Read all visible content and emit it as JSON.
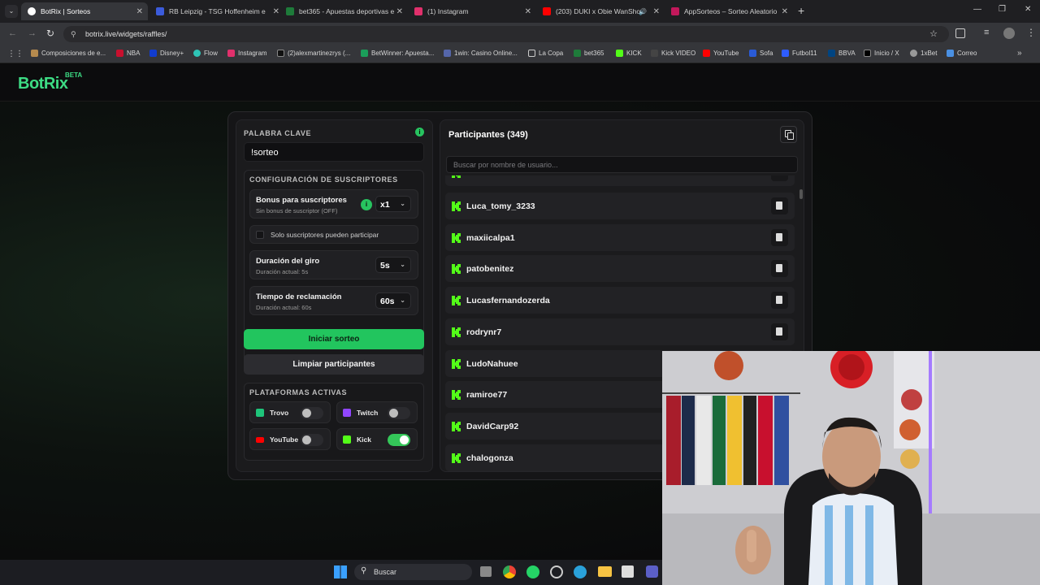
{
  "browser": {
    "tabs": [
      {
        "title": "BotRix | Sorteos",
        "active": true,
        "color": "#ffffff"
      },
      {
        "title": "RB Leipzig - TSG Hoffenheim e",
        "active": false,
        "color": "#3b5bdb"
      },
      {
        "title": "bet365 - Apuestas deportivas e",
        "active": false,
        "color": "#1e7b3a"
      },
      {
        "title": "(1) Instagram",
        "active": false,
        "color": "#e1306c"
      },
      {
        "title": "(203) DUKI x Obie WanShot",
        "active": false,
        "color": "#ff0000"
      },
      {
        "title": "AppSorteos – Sorteo Aleatorio",
        "active": false,
        "color": "#c2185b"
      }
    ],
    "url": "botrix.live/widgets/raffles/",
    "bookmarks": [
      "Composiciones de e...",
      "NBA",
      "Disney+",
      "Flow",
      "Instagram",
      "(2)alexmartinezrys (...",
      "BetWinner: Apuesta...",
      "1win: Casino Online...",
      "La Copa",
      "bet365",
      "KICK",
      "Kick VIDEO",
      "YouTube",
      "Sofa",
      "Futbol11",
      "BBVA",
      "Inicio / X",
      "1xBet",
      "Correo"
    ]
  },
  "app": {
    "logo": "BotRix",
    "badge": "BETA"
  },
  "keyword": {
    "label": "PALABRA CLAVE",
    "value": "!sorteo"
  },
  "subscribers": {
    "section_title": "CONFIGURACIÓN DE SUSCRIPTORES",
    "bonus_title": "Bonus para suscriptores",
    "bonus_sub": "Sin bonus de suscriptor (OFF)",
    "bonus_value": "x1",
    "only_subs_label": "Solo suscriptores pueden participar",
    "spin_title": "Duración del giro",
    "spin_sub": "Duración actual: 5s",
    "spin_value": "5s",
    "claim_title": "Tiempo de reclamación",
    "claim_sub": "Duración actual: 60s",
    "claim_value": "60s"
  },
  "buttons": {
    "start": "Iniciar sorteo",
    "clear": "Limpiar participantes"
  },
  "platforms": {
    "title": "PLATAFORMAS ACTIVAS",
    "items": [
      {
        "name": "Trovo",
        "on": false,
        "color": "#1ec47a"
      },
      {
        "name": "Twitch",
        "on": false,
        "color": "#9146ff"
      },
      {
        "name": "YouTube",
        "on": false,
        "color": "#ff0000"
      },
      {
        "name": "Kick",
        "on": true,
        "color": "#53fc18"
      }
    ]
  },
  "participants": {
    "title": "Participantes (349)",
    "search_placeholder": "Buscar por nombre de usuario...",
    "list": [
      "Luca_tomy_3233",
      "maxiicalpa1",
      "patobenitez",
      "Lucasfernandozerda",
      "rodrynr7",
      "LudoNahuee",
      "ramiroe77",
      "DavidCarp92",
      "chalogonza"
    ]
  },
  "taskbar": {
    "search_label": "Buscar"
  },
  "colors": {
    "accent": "#22c55e",
    "kick": "#53fc18"
  }
}
